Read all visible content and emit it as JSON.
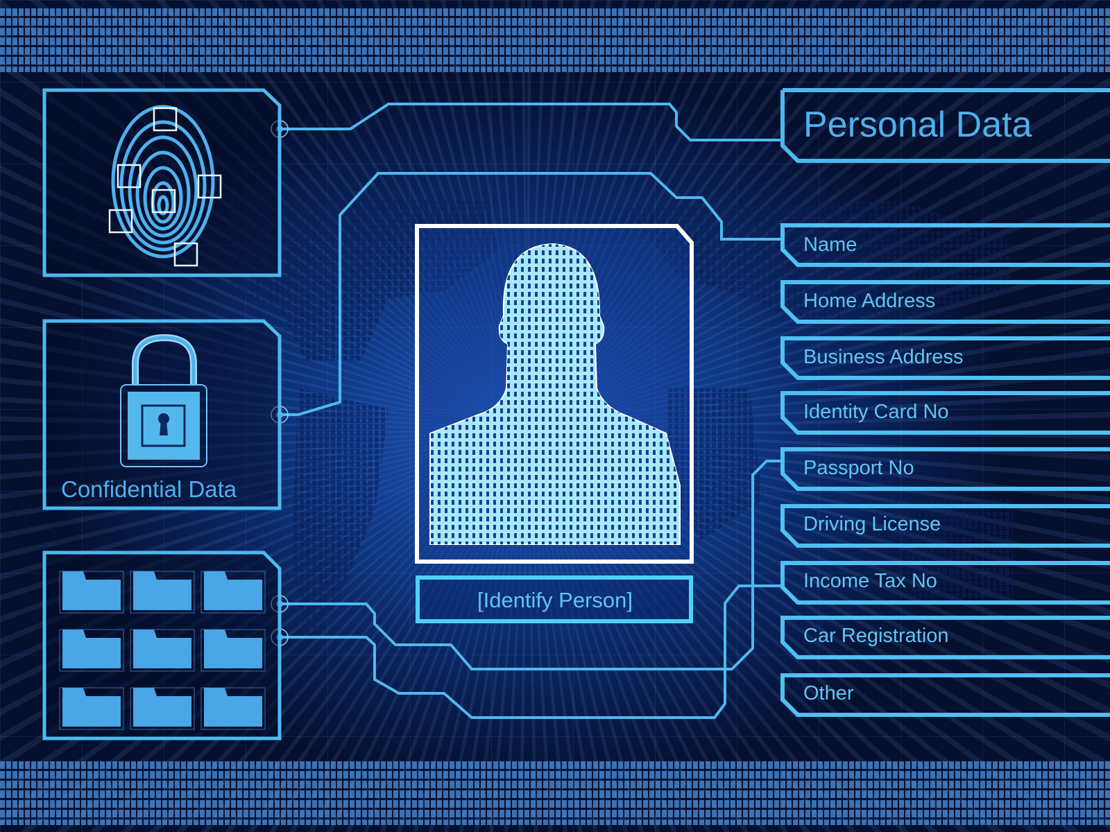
{
  "header": {
    "title": "Personal Data"
  },
  "personal_data_fields": [
    {
      "label": "Name"
    },
    {
      "label": "Home Address"
    },
    {
      "label": "Business Address"
    },
    {
      "label": "Identity Card No"
    },
    {
      "label": "Passport No"
    },
    {
      "label": "Driving License"
    },
    {
      "label": "Income Tax No"
    },
    {
      "label": "Car Registration"
    },
    {
      "label": "Other"
    }
  ],
  "left_panels": {
    "fingerprint": {
      "icon": "fingerprint-icon",
      "scan_markers": 6
    },
    "confidential": {
      "icon": "padlock-icon",
      "label": "Confidential Data"
    },
    "folders": {
      "icon": "folder-icon",
      "count": 9
    }
  },
  "center": {
    "portrait_icon": "person-silhouette-icon",
    "action_label": "[Identify Person]"
  },
  "colors": {
    "accent": "#4fb8ee",
    "text": "#62c4f2",
    "frame_white": "#ffffff",
    "background_dark": "#050f2e",
    "background_mid": "#123f92"
  }
}
